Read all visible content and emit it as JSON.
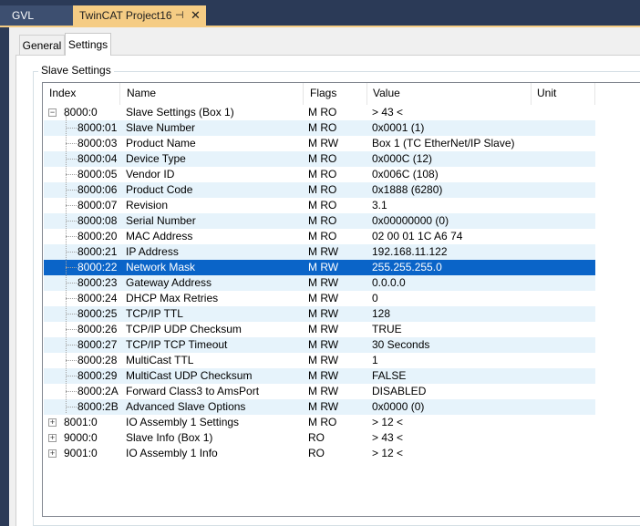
{
  "tabs": {
    "gvl": "GVL",
    "project": "TwinCAT Project16",
    "pin_glyph": "⊣",
    "close_glyph": "✕"
  },
  "property_tabs": [
    "General",
    "Settings"
  ],
  "group_label": "Slave Settings",
  "columns": [
    "Index",
    "Name",
    "Flags",
    "Value",
    "Unit"
  ],
  "rows": [
    {
      "index": "8000:0",
      "name": "Slave Settings (Box 1)",
      "flags": "M RO",
      "value": "> 43 <",
      "level": 0,
      "expander": "−"
    },
    {
      "index": "8000:01",
      "name": "Slave Number",
      "flags": "M RO",
      "value": "0x0001 (1)",
      "level": 1
    },
    {
      "index": "8000:03",
      "name": "Product Name",
      "flags": "M RW",
      "value": "Box 1 (TC EtherNet/IP Slave)",
      "level": 1
    },
    {
      "index": "8000:04",
      "name": "Device Type",
      "flags": "M RO",
      "value": "0x000C (12)",
      "level": 1
    },
    {
      "index": "8000:05",
      "name": "Vendor ID",
      "flags": "M RO",
      "value": "0x006C (108)",
      "level": 1
    },
    {
      "index": "8000:06",
      "name": "Product Code",
      "flags": "M RO",
      "value": "0x1888 (6280)",
      "level": 1
    },
    {
      "index": "8000:07",
      "name": "Revision",
      "flags": "M RO",
      "value": "3.1",
      "level": 1
    },
    {
      "index": "8000:08",
      "name": "Serial Number",
      "flags": "M RO",
      "value": "0x00000000 (0)",
      "level": 1
    },
    {
      "index": "8000:20",
      "name": "MAC Address",
      "flags": "M RO",
      "value": "02 00 01 1C A6 74",
      "level": 1
    },
    {
      "index": "8000:21",
      "name": "IP Address",
      "flags": "M RW",
      "value": "192.168.11.122",
      "level": 1
    },
    {
      "index": "8000:22",
      "name": "Network Mask",
      "flags": "M RW",
      "value": "255.255.255.0",
      "level": 1,
      "selected": true
    },
    {
      "index": "8000:23",
      "name": "Gateway Address",
      "flags": "M RW",
      "value": "0.0.0.0",
      "level": 1
    },
    {
      "index": "8000:24",
      "name": "DHCP Max Retries",
      "flags": "M RW",
      "value": "0",
      "level": 1
    },
    {
      "index": "8000:25",
      "name": "TCP/IP TTL",
      "flags": "M RW",
      "value": "128",
      "level": 1
    },
    {
      "index": "8000:26",
      "name": "TCP/IP UDP Checksum",
      "flags": "M RW",
      "value": "TRUE",
      "level": 1
    },
    {
      "index": "8000:27",
      "name": "TCP/IP TCP Timeout",
      "flags": "M RW",
      "value": "30 Seconds",
      "level": 1
    },
    {
      "index": "8000:28",
      "name": "MultiCast TTL",
      "flags": "M RW",
      "value": "1",
      "level": 1
    },
    {
      "index": "8000:29",
      "name": "MultiCast UDP Checksum",
      "flags": "M RW",
      "value": "FALSE",
      "level": 1
    },
    {
      "index": "8000:2A",
      "name": "Forward Class3 to AmsPort",
      "flags": "M RW",
      "value": "DISABLED",
      "level": 1
    },
    {
      "index": "8000:2B",
      "name": "Advanced Slave Options",
      "flags": "M RW",
      "value": "0x0000 (0)",
      "level": 1
    },
    {
      "index": "8001:0",
      "name": "IO Assembly 1 Settings",
      "flags": "M RO",
      "value": "> 12 <",
      "level": 0,
      "expander": "+"
    },
    {
      "index": "9000:0",
      "name": "Slave Info (Box 1)",
      "flags": "RO",
      "value": "> 43 <",
      "level": 0,
      "expander": "+"
    },
    {
      "index": "9001:0",
      "name": "IO Assembly 1 Info",
      "flags": "RO",
      "value": "> 12 <",
      "level": 0,
      "expander": "+"
    }
  ]
}
